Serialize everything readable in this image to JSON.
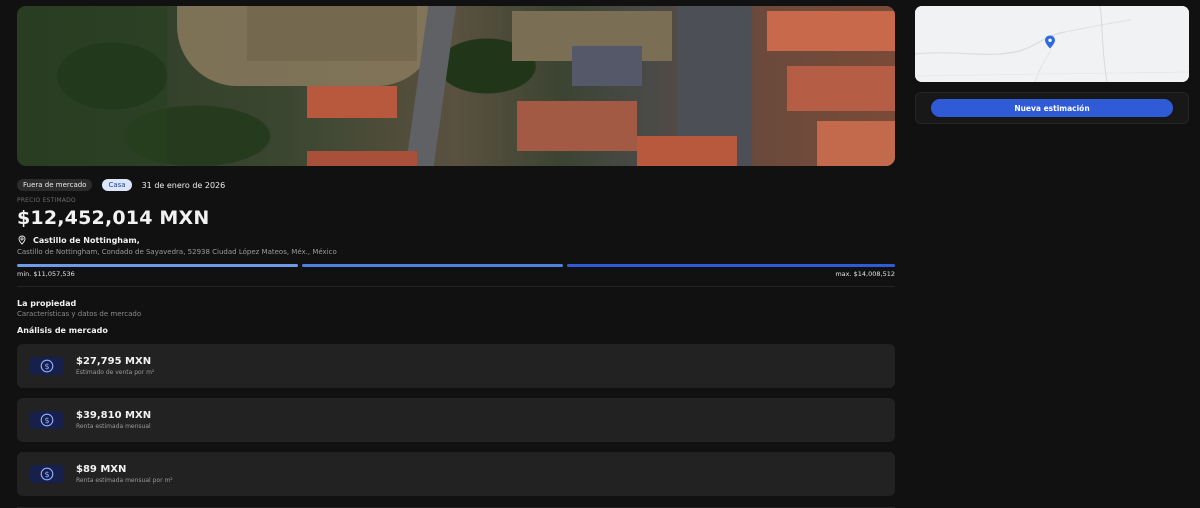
{
  "property": {
    "status_badge": "Fuera de mercado",
    "type_badge": "Casa",
    "date": "31 de enero de 2026",
    "price_label": "PRECIO ESTIMADO",
    "price": "$12,452,014 MXN",
    "address_title": "Castillo de Nottingham,",
    "address_full": "Castillo de Nottingham, Condado de Sayavedra, 52938 Ciudad López Mateos, Méx., México",
    "range_min": "min. $11,057,536",
    "range_max": "max. $14,008,512"
  },
  "section": {
    "title": "La propiedad",
    "subtitle": "Características y datos de mercado",
    "market_title": "Análisis de mercado"
  },
  "market_cards": [
    {
      "value": "$27,795 MXN",
      "label": "Estimado de venta por m²",
      "icon": "dollar-icon"
    },
    {
      "value": "$39,810 MXN",
      "label": "Renta estimada mensual",
      "icon": "dollar-icon"
    },
    {
      "value": "$89 MXN",
      "label": "Renta estimada mensual por m²",
      "icon": "dollar-icon"
    }
  ],
  "sidebar": {
    "button_label": "Nueva estimación"
  },
  "colors": {
    "accent": "#2f5bd6",
    "background": "#111111",
    "card": "#222222",
    "range_light": "#6f9ae8",
    "range_dark": "#2f5bd6"
  }
}
